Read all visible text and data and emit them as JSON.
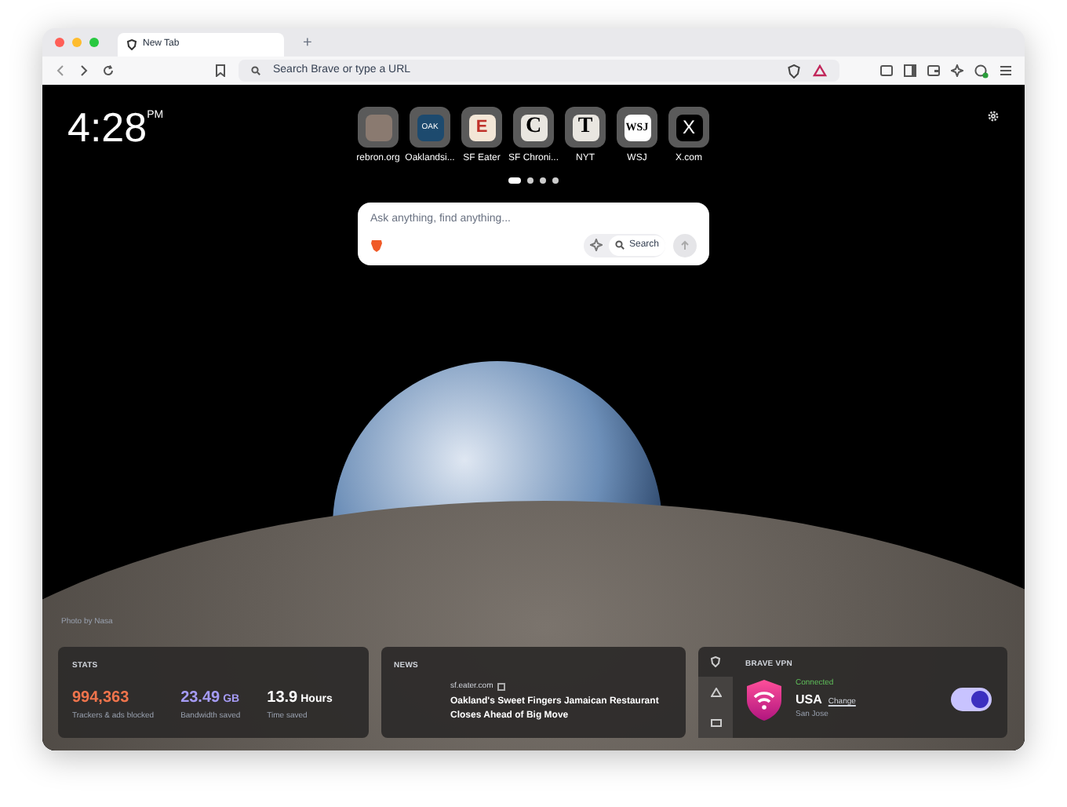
{
  "tabs": [
    {
      "title": "New Tab",
      "selected": true
    }
  ],
  "address_bar": {
    "placeholder": "Search Brave or type a URL"
  },
  "clock": {
    "time": "4:28",
    "period": "PM"
  },
  "new_tab_button": "+",
  "top_sites": [
    {
      "label": "rebron.org"
    },
    {
      "label": "Oaklandsi...",
      "glyph": "OAK"
    },
    {
      "label": "SF Eater",
      "glyph": "E"
    },
    {
      "label": "SF Chroni...",
      "glyph": "C"
    },
    {
      "label": "NYT",
      "glyph": "T"
    },
    {
      "label": "WSJ",
      "glyph": "WSJ"
    },
    {
      "label": "X.com",
      "glyph": "X"
    }
  ],
  "pages": [
    {
      "selected": true
    },
    {
      "selected": false
    },
    {
      "selected": false
    },
    {
      "selected": false
    }
  ],
  "search": {
    "placeholder": "Ask anything, find anything...",
    "button": "Search"
  },
  "photo_credit": "Photo by Nasa",
  "stats": {
    "title": "STATS",
    "items": [
      {
        "value": "994,363",
        "caption": "Trackers & ads blocked",
        "color": "#f0744c"
      },
      {
        "value": "23.49",
        "unit": "GB",
        "caption": "Bandwidth saved",
        "color": "#a59bf5"
      },
      {
        "value": "13.9",
        "unit": "Hours",
        "caption": "Time saved",
        "color": "#ffffff"
      }
    ]
  },
  "news": {
    "title": "NEWS",
    "source": "sf.eater.com",
    "headline": "Oakland's Sweet Fingers Jamaican Restaurant Closes Ahead of Big Move"
  },
  "vpn": {
    "title": "BRAVE VPN",
    "status": "Connected",
    "country": "USA",
    "change": "Change",
    "city": "San Jose",
    "on": true
  }
}
